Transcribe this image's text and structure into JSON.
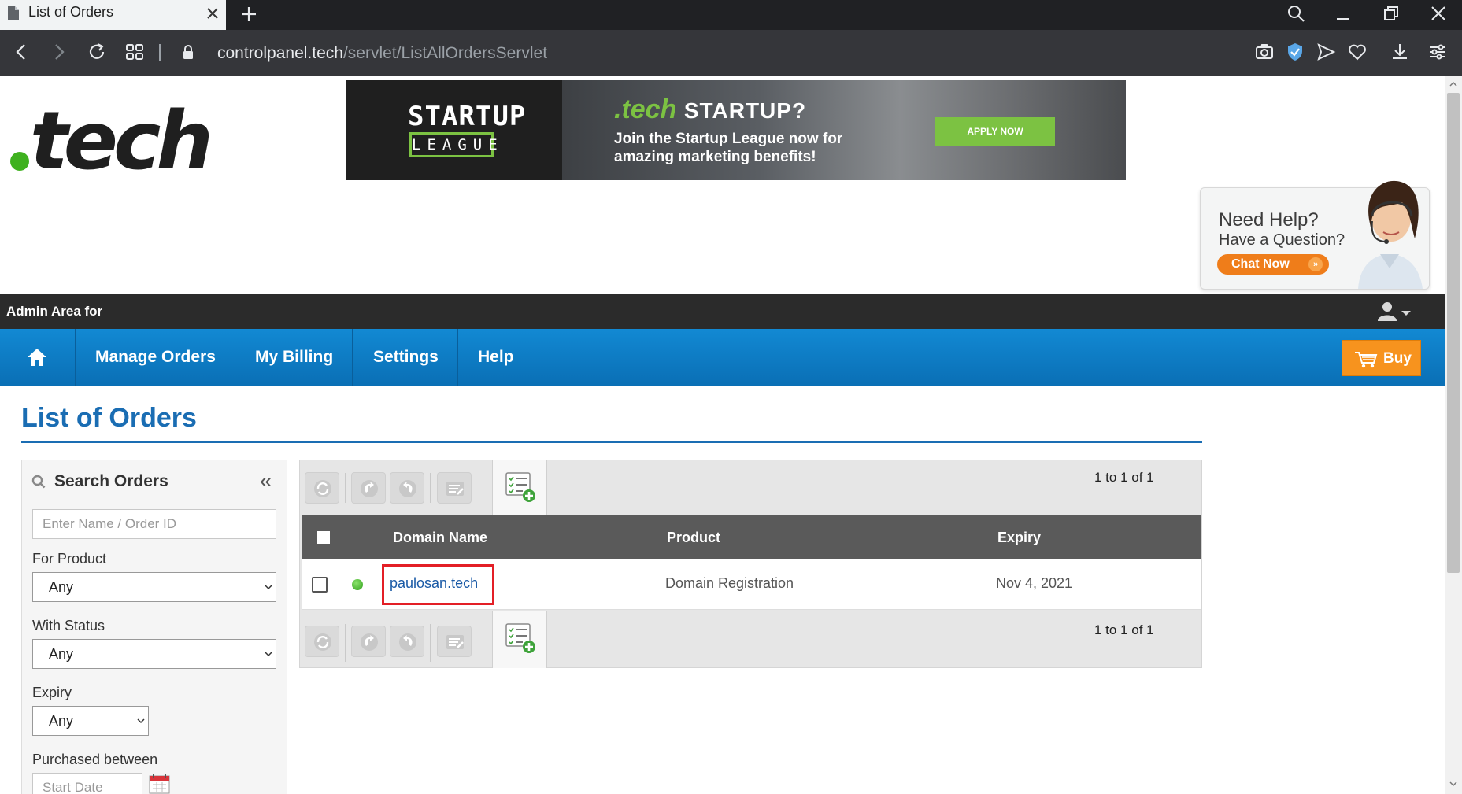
{
  "browser": {
    "tab_title": "List of Orders",
    "url_host": "controlpanel.tech",
    "url_path": "/servlet/ListAllOrdersServlet"
  },
  "banner": {
    "left_title": "STARTUP",
    "left_subtitle": "LEAGUE",
    "brand": ".tech",
    "headline": "STARTUP?",
    "line1": "Join the Startup League now for",
    "line2": "amazing marketing benefits!",
    "cta": "APPLY NOW"
  },
  "help_widget": {
    "title": "Need Help?",
    "subtitle": "Have a Question?",
    "chat_label": "Chat Now"
  },
  "admin_bar": {
    "title": "Admin Area for"
  },
  "nav": {
    "items": [
      "Manage Orders",
      "My Billing",
      "Settings",
      "Help"
    ],
    "buy_label": "Buy"
  },
  "page": {
    "title": "List of Orders"
  },
  "search": {
    "title": "Search Orders",
    "collapse_glyph": "«",
    "input_placeholder": "Enter Name / Order ID",
    "product_label": "For Product",
    "product_value": "Any",
    "status_label": "With Status",
    "status_value": "Any",
    "expiry_label": "Expiry",
    "expiry_value": "Any",
    "purchased_label": "Purchased between",
    "start_date_placeholder": "Start Date"
  },
  "orders": {
    "pager_top": "1 to 1 of 1",
    "pager_bottom": "1 to 1 of 1",
    "columns": {
      "domain": "Domain Name",
      "product": "Product",
      "expiry": "Expiry"
    },
    "rows": [
      {
        "domain": "paulosan.tech",
        "product": "Domain Registration",
        "expiry": "Nov 4, 2021",
        "status": "active"
      }
    ]
  },
  "colors": {
    "nav_blue": "#0a7bc4",
    "title_blue": "#1a6db3",
    "buy_orange": "#f7931e",
    "highlight_red": "#e31f26",
    "status_green": "#3fb11f"
  }
}
